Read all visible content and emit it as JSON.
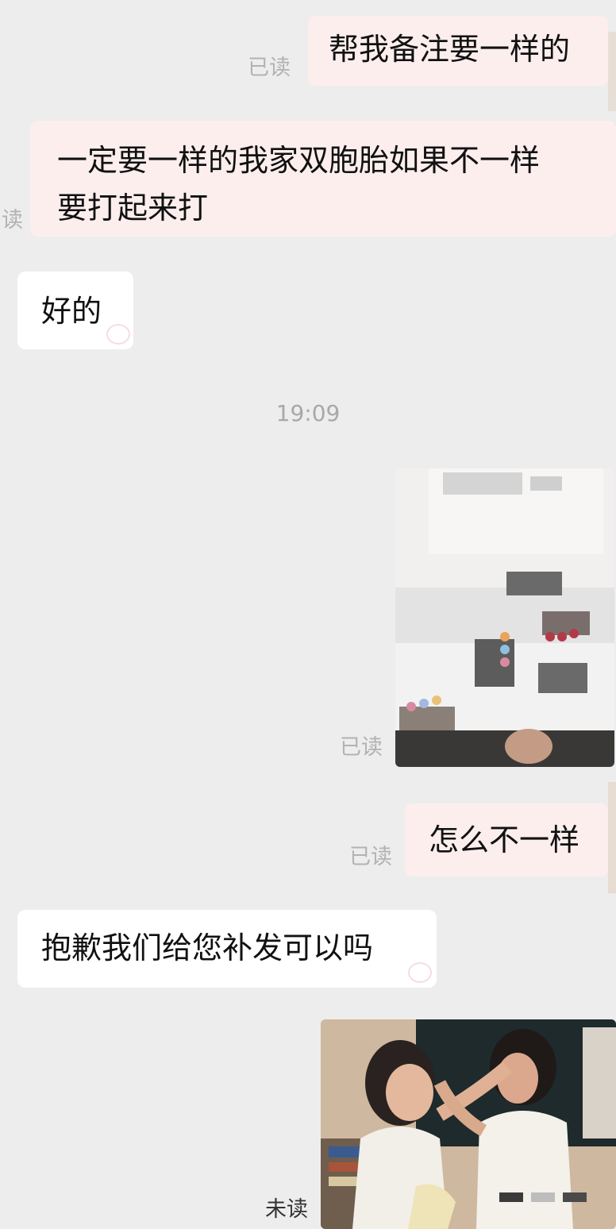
{
  "messages": [
    {
      "id": "m1",
      "direction": "out",
      "text": "帮我备注要一样的",
      "status": "已读"
    },
    {
      "id": "m2",
      "direction": "out",
      "text_line1": "一定要一样的我家双胞胎如果不一样",
      "text_line2": "要打起来打",
      "status": "读"
    },
    {
      "id": "m3",
      "direction": "in",
      "text": "好的"
    },
    {
      "id": "m4",
      "direction": "out",
      "type": "image",
      "image_name": "hair-clips-photo",
      "status": "已读"
    },
    {
      "id": "m5",
      "direction": "out",
      "text": "怎么不一样",
      "status": "已读"
    },
    {
      "id": "m6",
      "direction": "in",
      "text": "抱歉我们给您补发可以吗"
    },
    {
      "id": "m7",
      "direction": "out",
      "type": "image",
      "image_name": "twins-fighting-photo",
      "status": "未读"
    }
  ],
  "time_divider": "19:09",
  "colors": {
    "background": "#ededed",
    "outgoing_bubble": "#fdeeee",
    "incoming_bubble": "#ffffff",
    "status_text": "#b2b2b2"
  }
}
